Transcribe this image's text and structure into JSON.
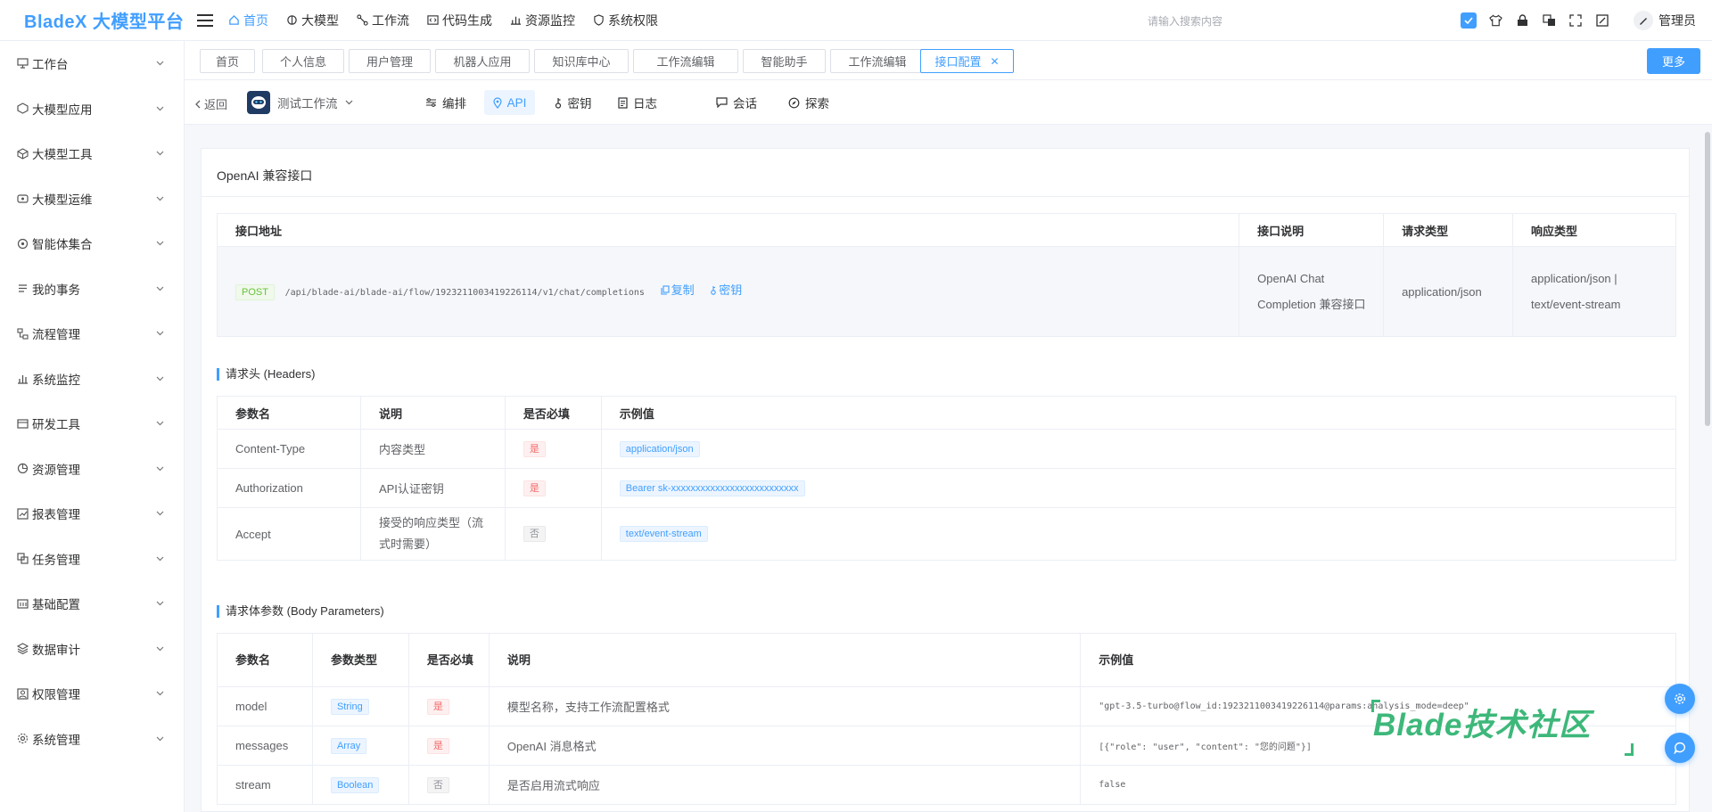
{
  "brand": "BladeX 大模型平台",
  "topnav": [
    {
      "label": "首页",
      "icon": "home-icon"
    },
    {
      "label": "大模型",
      "icon": "brain-icon"
    },
    {
      "label": "工作流",
      "icon": "workflow-icon"
    },
    {
      "label": "代码生成",
      "icon": "code-icon"
    },
    {
      "label": "资源监控",
      "icon": "monitor-icon"
    },
    {
      "label": "系统权限",
      "icon": "shield-icon"
    }
  ],
  "search_placeholder": "请输入搜索内容",
  "user_name": "管理员",
  "sidebar": [
    {
      "label": "工作台",
      "icon": "desktop-icon"
    },
    {
      "label": "大模型应用",
      "icon": "cube-icon"
    },
    {
      "label": "大模型工具",
      "icon": "box-icon"
    },
    {
      "label": "大模型运维",
      "icon": "ops-icon"
    },
    {
      "label": "智能体集合",
      "icon": "agent-icon"
    },
    {
      "label": "我的事务",
      "icon": "task-icon"
    },
    {
      "label": "流程管理",
      "icon": "flow-icon"
    },
    {
      "label": "系统监控",
      "icon": "monitor-icon"
    },
    {
      "label": "研发工具",
      "icon": "tool-icon"
    },
    {
      "label": "资源管理",
      "icon": "resource-icon"
    },
    {
      "label": "报表管理",
      "icon": "report-icon"
    },
    {
      "label": "任务管理",
      "icon": "job-icon"
    },
    {
      "label": "基础配置",
      "icon": "config-icon"
    },
    {
      "label": "数据审计",
      "icon": "audit-icon"
    },
    {
      "label": "权限管理",
      "icon": "permission-icon"
    },
    {
      "label": "系统管理",
      "icon": "settings-icon"
    }
  ],
  "tabs": [
    "首页",
    "个人信息",
    "用户管理",
    "机器人应用",
    "知识库中心",
    "工作流编辑",
    "智能助手",
    "工作流编辑",
    "接口配置"
  ],
  "more_label": "更多",
  "subheader": {
    "back": "返回",
    "workflow_name": "测试工作流",
    "tabs": [
      "编排",
      "API",
      "密钥",
      "日志",
      "会话",
      "探索"
    ]
  },
  "card_title": "OpenAI 兼容接口",
  "api_table": {
    "headers": [
      "接口地址",
      "接口说明",
      "请求类型",
      "响应类型"
    ],
    "method": "POST",
    "path": "/api/blade-ai/blade-ai/flow/1923211003419226114/v1/chat/completions",
    "copy_label": "复制",
    "key_label": "密钥",
    "description": "OpenAI Chat Completion 兼容接口",
    "request_type": "application/json",
    "response_type": "application/json | text/event-stream"
  },
  "headers_section": {
    "title": "请求头 (Headers)",
    "columns": [
      "参数名",
      "说明",
      "是否必填",
      "示例值"
    ],
    "rows": [
      {
        "name": "Content-Type",
        "desc": "内容类型",
        "required": "是",
        "example": "application/json"
      },
      {
        "name": "Authorization",
        "desc": "API认证密钥",
        "required": "是",
        "example": "Bearer sk-xxxxxxxxxxxxxxxxxxxxxxxxxx"
      },
      {
        "name": "Accept",
        "desc": "接受的响应类型（流式时需要）",
        "required": "否",
        "example": "text/event-stream"
      }
    ]
  },
  "body_section": {
    "title": "请求体参数 (Body Parameters)",
    "columns": [
      "参数名",
      "参数类型",
      "是否必填",
      "说明",
      "示例值"
    ],
    "rows": [
      {
        "name": "model",
        "type": "String",
        "required": "是",
        "desc": "模型名称，支持工作流配置格式",
        "example": "\"gpt-3.5-turbo@flow_id:1923211003419226114@params:analysis_mode=deep\""
      },
      {
        "name": "messages",
        "type": "Array",
        "required": "是",
        "desc": "OpenAI 消息格式",
        "example": "[{\"role\": \"user\", \"content\": \"您的问题\"}]"
      },
      {
        "name": "stream",
        "type": "Boolean",
        "required": "否",
        "desc": "是否启用流式响应",
        "example": "false"
      }
    ]
  },
  "watermark": "Blade技术社区",
  "colors": {
    "accent": "#409eff",
    "danger": "#f56c6c",
    "success": "#67c23a",
    "watermark": "#3db87a"
  }
}
